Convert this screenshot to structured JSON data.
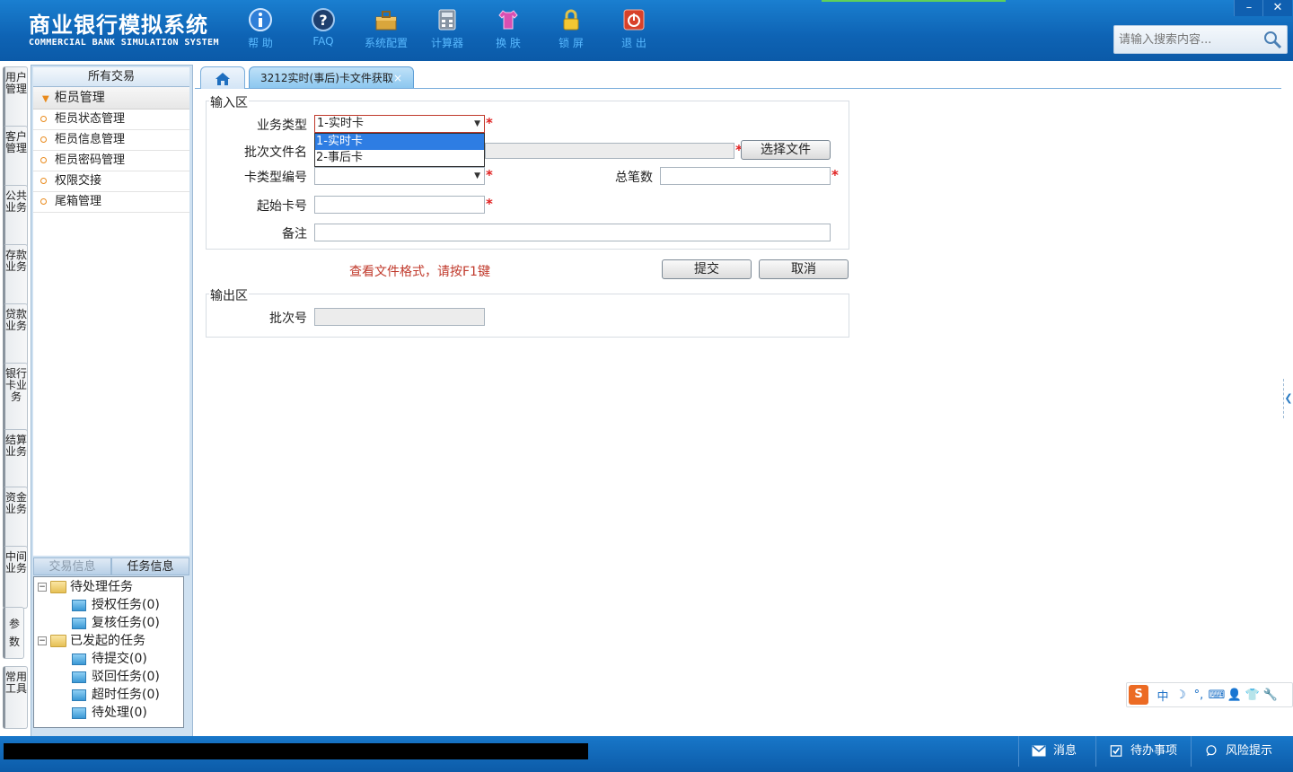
{
  "header": {
    "title": "商业银行模拟系统",
    "subtitle": "COMMERCIAL BANK SIMULATION SYSTEM",
    "tools": [
      {
        "label": "帮 助",
        "icon": "info-icon"
      },
      {
        "label": "FAQ",
        "icon": "question-icon"
      },
      {
        "label": "系统配置",
        "icon": "toolbox-icon"
      },
      {
        "label": "计算器",
        "icon": "calculator-icon"
      },
      {
        "label": "换 肤",
        "icon": "shirt-icon"
      },
      {
        "label": "锁 屏",
        "icon": "lock-icon"
      },
      {
        "label": "退 出",
        "icon": "power-icon"
      }
    ],
    "search_placeholder": "请输入搜索内容...",
    "window_buttons": {
      "minimize": "–",
      "close": "✕"
    }
  },
  "vertical_tabs": [
    "用户管理",
    "客户管理",
    "公共业务",
    "存款业务",
    "贷款业务",
    "银行卡业务",
    "结算业务",
    "资金业务",
    "中间业务",
    "参数",
    "常用工具"
  ],
  "sidebar": {
    "header": "所有交易",
    "group": "柜员管理",
    "items": [
      "柜员状态管理",
      "柜员信息管理",
      "柜员密码管理",
      "权限交接",
      "尾箱管理"
    ],
    "task_tabs": [
      "交易信息",
      "任务信息"
    ],
    "tree": {
      "pending": "待处理任务",
      "pending_children": [
        "授权任务(0)",
        "复核任务(0)"
      ],
      "started": "已发起的任务",
      "started_children": [
        "待提交(0)",
        "驳回任务(0)",
        "超时任务(0)",
        "待处理(0)"
      ]
    }
  },
  "tabs": {
    "active": "3212实时(事后)卡文件获取",
    "close": "×"
  },
  "form": {
    "input_legend": "输入区",
    "business_type_label": "业务类型",
    "business_type_value": "1-实时卡",
    "business_type_options": [
      "1-实时卡",
      "2-事后卡"
    ],
    "batch_file_label": "批次文件名",
    "select_file_button": "选择文件",
    "card_type_label": "卡类型编号",
    "total_count_label": "总笔数",
    "start_card_label": "起始卡号",
    "remark_label": "备注",
    "required_mark": "*",
    "hint": "查看文件格式，请按F1键",
    "submit_button": "提交",
    "cancel_button": "取消",
    "output_legend": "输出区",
    "batch_no_label": "批次号"
  },
  "ime": {
    "logo": "S",
    "items": [
      "中",
      "☽",
      "°,",
      "⌨",
      "👤",
      "👕",
      "🔧"
    ]
  },
  "statusbar": {
    "messages": "消息",
    "todo": "待办事项",
    "risk": "风险提示"
  },
  "colors": {
    "header_blue": "#0e63b4",
    "accent_red": "#e02020",
    "hint_red": "#c0392b",
    "selected_option": "#2e7de3"
  }
}
